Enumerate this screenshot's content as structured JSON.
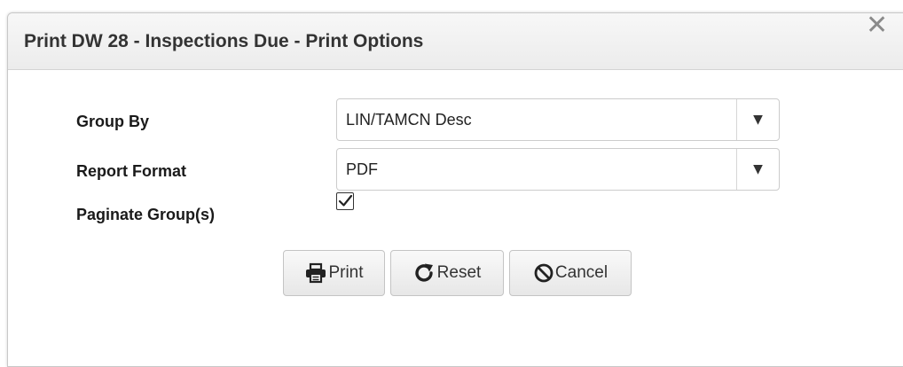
{
  "dialog": {
    "title": "Print DW 28 - Inspections Due - Print Options",
    "close_icon": "close-icon"
  },
  "form": {
    "group_by": {
      "label": "Group By",
      "value": "LIN/TAMCN Desc",
      "icon": "caret-down-icon"
    },
    "report_format": {
      "label": "Report Format",
      "value": "PDF",
      "icon": "caret-down-icon"
    },
    "paginate": {
      "label": "Paginate Group(s)",
      "checked": true
    }
  },
  "buttons": {
    "print": {
      "label": "Print",
      "icon": "printer-icon"
    },
    "reset": {
      "label": "Reset",
      "icon": "refresh-icon"
    },
    "cancel": {
      "label": "Cancel",
      "icon": "ban-icon"
    }
  },
  "colors": {
    "title_bar": "#ececec",
    "border": "#cccccc",
    "text": "#333333"
  }
}
